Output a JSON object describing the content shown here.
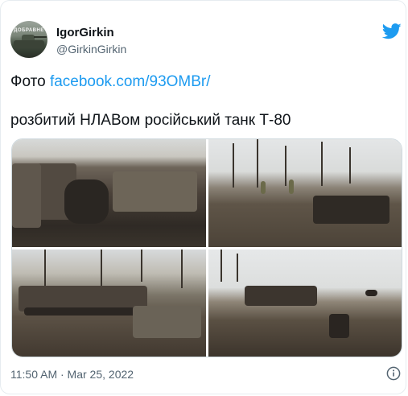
{
  "author": {
    "display_name": "IgorGirkin",
    "handle": "@GirkinGirkin",
    "avatar_text": "ДОБРАВНЕ"
  },
  "tweet": {
    "text_prefix": "Фото ",
    "link_text": "facebook.com/93OMBr/",
    "text_body": "розбитий НЛАВом російський танк Т-80"
  },
  "media": {
    "count": 4
  },
  "footer": {
    "timestamp": "11:50 AM · Mar 25, 2022"
  },
  "icons": {
    "brand": "twitter-bird-icon",
    "info": "info-icon"
  },
  "colors": {
    "link": "#1d9bf0",
    "brand": "#1d9bf0",
    "text": "#0f1419",
    "secondary": "#536471"
  }
}
